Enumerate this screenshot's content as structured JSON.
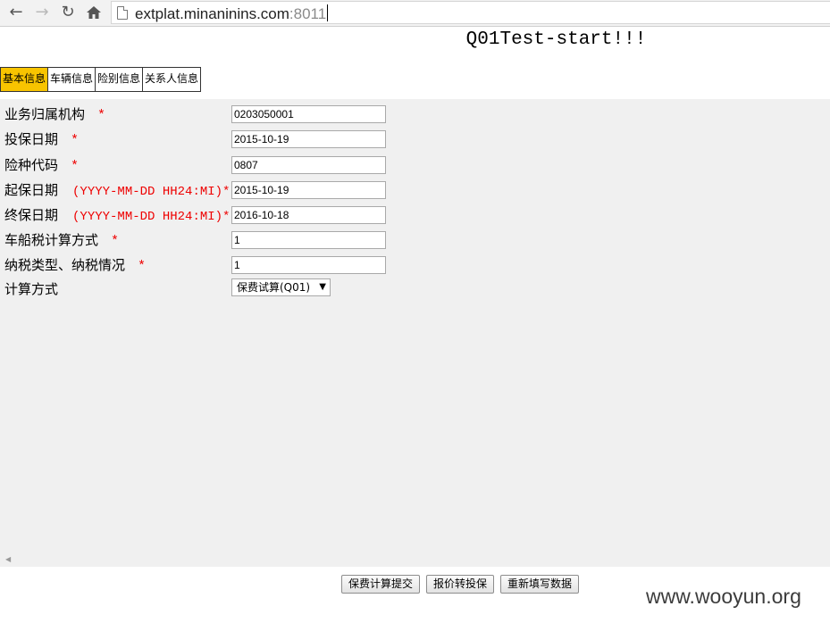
{
  "browser": {
    "url_host": "extplat.minaninins.com",
    "url_port": ":8011"
  },
  "page": {
    "title": "Q01Test-start!!!"
  },
  "tabs": [
    {
      "label": "基本信息",
      "active": true
    },
    {
      "label": "车辆信息",
      "active": false
    },
    {
      "label": "险别信息",
      "active": false
    },
    {
      "label": "关系人信息",
      "active": false
    }
  ],
  "form": {
    "fields": [
      {
        "label": "业务归属机构",
        "note": "",
        "required_mark": "*",
        "value": "0203050001"
      },
      {
        "label": "投保日期",
        "note": "",
        "required_mark": "*",
        "value": "2015-10-19"
      },
      {
        "label": "险种代码",
        "note": "",
        "required_mark": "*",
        "value": "0807"
      },
      {
        "label": "起保日期",
        "note": "(YYYY-MM-DD HH24:MI)*",
        "required_mark": "",
        "value": "2015-10-19"
      },
      {
        "label": "终保日期",
        "note": "(YYYY-MM-DD HH24:MI)*",
        "required_mark": "",
        "value": "2016-10-18"
      },
      {
        "label": "车船税计算方式",
        "note": "",
        "required_mark": "*",
        "value": "1"
      },
      {
        "label": "纳税类型、纳税情况",
        "note": "",
        "required_mark": "*",
        "value": "1"
      }
    ],
    "calc_method": {
      "label": "计算方式",
      "selected": "保费试算(Q01)"
    }
  },
  "actions": {
    "submit_calc": "保费计算提交",
    "quote_to_insure": "报价转投保",
    "refill": "重新填写数据"
  },
  "watermark": "www.wooyun.org",
  "colors": {
    "active_tab": "#f8c400",
    "required": "#ee0000",
    "panel_bg": "#f0f0f0"
  }
}
